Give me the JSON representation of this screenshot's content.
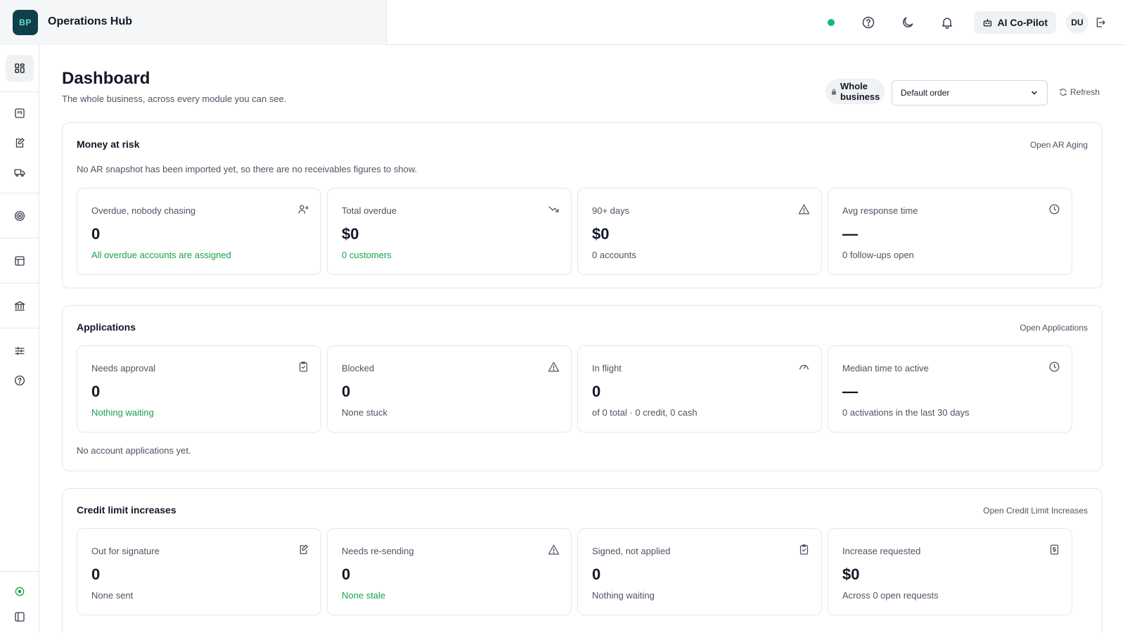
{
  "brand": {
    "logo": "BP",
    "name": "Operations Hub"
  },
  "topbar": {
    "status_color": "#10b981",
    "icons": [
      "help-icon",
      "moon-icon",
      "bell-icon"
    ],
    "copilot_label": "AI Co-Pilot",
    "avatar": "DU"
  },
  "sidebar": {
    "items": [
      "dashboard-icon",
      "kanban-icon",
      "edit-icon",
      "truck-icon",
      "target-icon",
      "table-icon",
      "bank-icon",
      "sliders-icon",
      "help-icon",
      "status-icon",
      "panel-icon"
    ]
  },
  "header": {
    "title": "Dashboard",
    "subtitle": "The whole business, across every module you can see.",
    "scope_label": "Whole business",
    "order_select": {
      "selected": "Default order"
    },
    "refresh_label": "Refresh"
  },
  "sections": {
    "money": {
      "title": "Money at risk",
      "link": "Open AR Aging",
      "note": "No AR snapshot has been imported yet, so there are no receivables figures to show.",
      "cards": [
        {
          "label": "Overdue, nobody chasing",
          "value": "0",
          "sub": "All overdue accounts are assigned",
          "icon": "user-x-icon"
        },
        {
          "label": "Total overdue",
          "value": "$0",
          "sub": "0 customers",
          "icon": "trending-down-icon"
        },
        {
          "label": "90+ days",
          "value": "$0",
          "sub": "0 accounts",
          "icon": "warning-icon"
        },
        {
          "label": "Avg response time",
          "value": "—",
          "sub": "0 follow-ups open",
          "icon": "clock-icon"
        }
      ]
    },
    "applications": {
      "title": "Applications",
      "link": "Open Applications",
      "note": "No account applications yet.",
      "cards": [
        {
          "label": "Needs approval",
          "value": "0",
          "sub": "Nothing waiting",
          "icon": "clipboard-check-icon"
        },
        {
          "label": "Blocked",
          "value": "0",
          "sub": "None stuck",
          "icon": "warning-icon"
        },
        {
          "label": "In flight",
          "value": "0",
          "sub": "of 0 total · 0 credit, 0 cash",
          "icon": "gauge-icon"
        },
        {
          "label": "Median time to active",
          "value": "—",
          "sub": "0 activations in the last 30 days",
          "icon": "clock-icon"
        }
      ]
    },
    "credit": {
      "title": "Credit limit increases",
      "link": "Open Credit Limit Increases",
      "cards": [
        {
          "label": "Out for signature",
          "value": "0",
          "sub": "None sent",
          "icon": "signature-icon"
        },
        {
          "label": "Needs re-sending",
          "value": "0",
          "sub": "None stale",
          "icon": "warning-icon"
        },
        {
          "label": "Signed, not applied",
          "value": "0",
          "sub": "Nothing waiting",
          "icon": "clipboard-check-icon"
        },
        {
          "label": "Increase requested",
          "value": "$0",
          "sub": "Across 0 open requests",
          "icon": "dollar-receipt-icon"
        }
      ]
    }
  },
  "colors": {
    "accent_green": "#16a34a",
    "brand_dark": "#0f3f4a",
    "brand_teal": "#5ee1c6"
  }
}
